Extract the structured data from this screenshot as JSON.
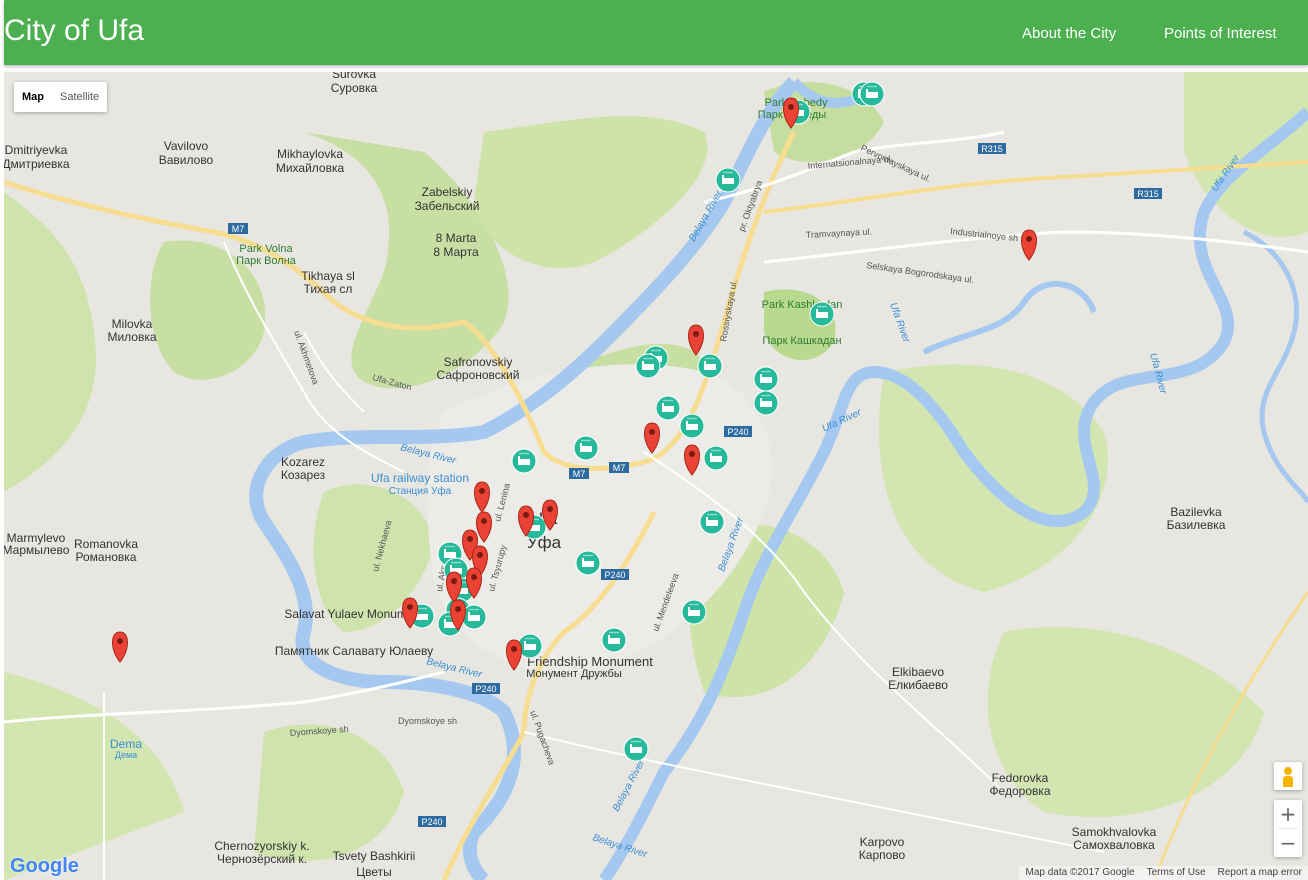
{
  "navbar": {
    "brand": "City of Ufa",
    "links": [
      "About the City",
      "Points of Interest"
    ],
    "color": "#4caf50"
  },
  "map": {
    "type_control": {
      "map": "Map",
      "satellite": "Satellite",
      "selected": "Map"
    },
    "zoom": {
      "in": "+",
      "out": "−"
    },
    "footer": {
      "data": "Map data ©2017 Google",
      "terms": "Terms of Use",
      "report": "Report a map error"
    },
    "logo": "Google",
    "colors": {
      "background": "#e5e3df",
      "park": "#c8dfa4",
      "water": "#a4c8f0",
      "road": "#ffffff",
      "highway": "#f7dd8f",
      "marker": "#ea4335",
      "hotel": "#26b99a"
    },
    "places": [
      {
        "en": "Surovka",
        "ru": "Суровка"
      },
      {
        "en": "Dmitriyevka",
        "ru": "Дмитриевка"
      },
      {
        "en": "Vavilovo",
        "ru": "Вавилово"
      },
      {
        "en": "Mikhaylovka",
        "ru": "Михайловка"
      },
      {
        "en": "Zabelskiy",
        "ru": "Забельский"
      },
      {
        "en": "8 Marta",
        "ru": "8 Марта"
      },
      {
        "en": "Park Volna",
        "ru": "Парк Волна"
      },
      {
        "en": "Tikhaya sl",
        "ru": "Тихая сл"
      },
      {
        "en": "Milovka",
        "ru": "Миловка"
      },
      {
        "en": "Safronovskiy",
        "ru": "Сафроновский"
      },
      {
        "en": "Kozarez",
        "ru": "Козарез"
      },
      {
        "en": "Ufa railway station",
        "ru": "Станция Уфа"
      },
      {
        "en": "Marmylevo",
        "ru": "Мармылево"
      },
      {
        "en": "Romanovka",
        "ru": "Романовка"
      },
      {
        "en": "Salavat Yulaev Monument",
        "ru": "Памятник Салавату Юлаеву"
      },
      {
        "en": "Friendship Monument",
        "ru": "Монумент Дружбы"
      },
      {
        "en": "Dema",
        "ru": "Дема"
      },
      {
        "en": "Chernozyorskiy k.",
        "ru": "Чернозёрский к."
      },
      {
        "en": "Tsvety Bashkirii",
        "ru": "Цветы"
      },
      {
        "en": "Park Kashkadan",
        "ru": "Парк Кашкадан"
      },
      {
        "en": "Park Pobedy",
        "ru": "Парк Победы"
      },
      {
        "en": "Bazilevka",
        "ru": "Базилевка"
      },
      {
        "en": "Elkibaevo",
        "ru": "Елкибаево"
      },
      {
        "en": "Fedorovka",
        "ru": "Федоровка"
      },
      {
        "en": "Samokhvalovka",
        "ru": "Самохваловка"
      },
      {
        "en": "Karpovo",
        "ru": "Карпово"
      },
      {
        "en": "Ufa",
        "ru": "Уфа"
      }
    ],
    "road_labels": [
      "M7",
      "R315",
      "P240",
      "Belaya River",
      "Ufa River",
      "Internatsionalnaya ul.",
      "Pervomayskaya ul.",
      "Tramvaynaya ul.",
      "Industrialnoye sh",
      "Selskaya Bogorodskaya ul.",
      "Rossiyskaya ul.",
      "pr. Oktyabrya",
      "ul. Lenina",
      "ul. Mendeleeva",
      "ul. Tsyurupy",
      "Dyomskoye sh",
      "ul. Aksakova",
      "ul. Nekhaeva",
      "ul. Akhmetova",
      "Ufa-Zaton",
      "ul. Pugacheva"
    ]
  }
}
